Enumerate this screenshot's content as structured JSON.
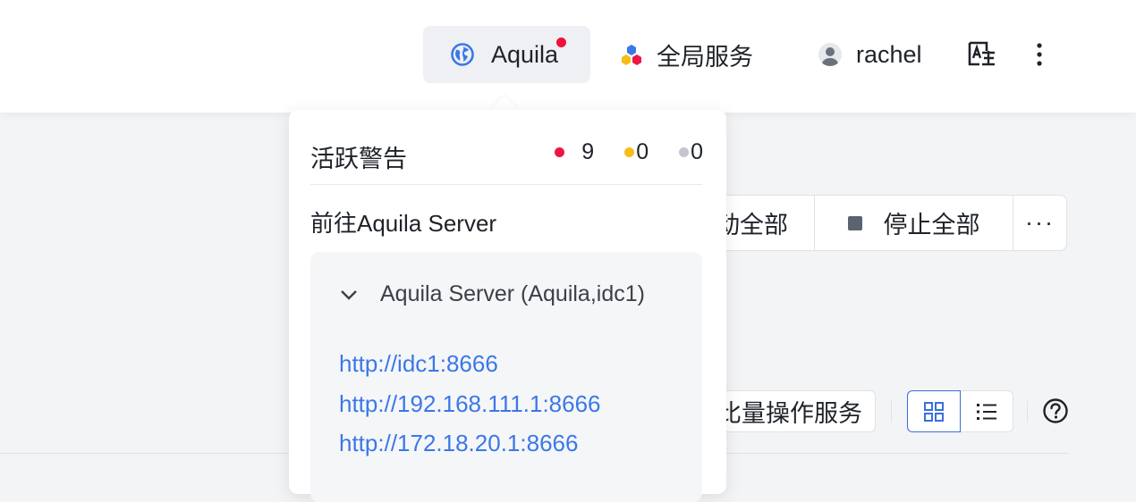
{
  "topbar": {
    "aquila": {
      "label": "Aquila",
      "icon": "globe-icon",
      "has_alert": true
    },
    "global_services": {
      "label": "全局服务",
      "icon": "cluster-icon"
    },
    "user": {
      "label": "rachel",
      "icon": "user-avatar-icon"
    },
    "translate_icon": "translate-icon",
    "more_icon": "more-vertical-icon"
  },
  "page": {
    "start_all_label": "动全部",
    "stop_all_label": "停止全部",
    "more_label": "···",
    "batch_label": "比量操作服务"
  },
  "popover": {
    "title": "活跃警告",
    "counts": {
      "red": "9",
      "yellow": "0",
      "gray": "0"
    },
    "goto_label": "前往Aquila Server",
    "server": {
      "name": "Aquila Server (Aquila,idc1)",
      "links": [
        "http://idc1:8666",
        "http://192.168.111.1:8666",
        "http://172.18.20.1:8666"
      ]
    }
  },
  "colors": {
    "link": "#3b78e7",
    "alert_red": "#ee1643",
    "warn_yellow": "#f5be1a",
    "neutral_gray": "#c3c6cc",
    "accent_blue": "#3a6fdc"
  }
}
